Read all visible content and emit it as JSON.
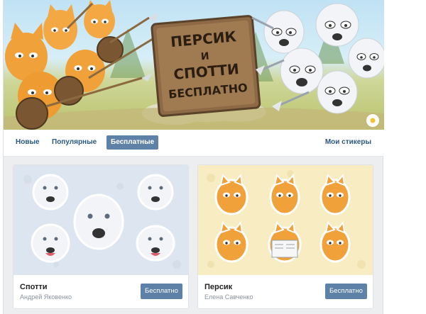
{
  "banner": {
    "title_lines": [
      "ПЕРСИК",
      "И",
      "СПОТТИ",
      "БЕСПЛАТНО"
    ]
  },
  "tabs": {
    "items": [
      {
        "label": "Новые",
        "active": false
      },
      {
        "label": "Популярные",
        "active": false
      },
      {
        "label": "Бесплатные",
        "active": true
      }
    ],
    "my_stickers": "Мои стикеры"
  },
  "packs": [
    {
      "title": "Спотти",
      "author": "Андрей Яковенко",
      "button": "Бесплатно"
    },
    {
      "title": "Персик",
      "author": "Елена Савченко",
      "button": "Бесплатно"
    }
  ],
  "colors": {
    "accent": "#5e81a8",
    "link": "#2a5885",
    "page_bg": "#edeef0"
  }
}
